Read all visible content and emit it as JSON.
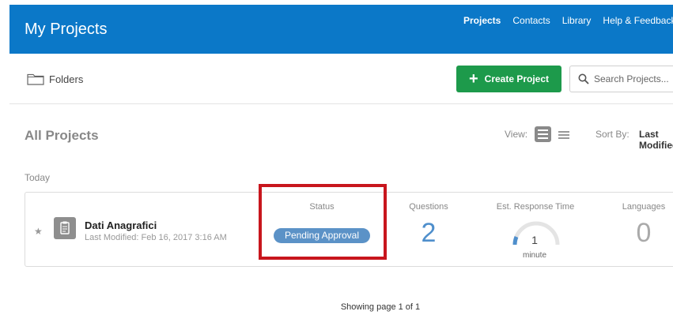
{
  "header": {
    "title": "My Projects",
    "nav": [
      "Projects",
      "Contacts",
      "Library",
      "Help & Feedback"
    ]
  },
  "toolbar": {
    "folders_label": "Folders",
    "create_label": "Create Project",
    "search_placeholder": "Search Projects..."
  },
  "list": {
    "section_title": "All Projects",
    "view_label": "View:",
    "sort_label": "Sort By:",
    "sort_value": "Last Modified",
    "group_label": "Today"
  },
  "project": {
    "name": "Dati Anagrafici",
    "last_modified": "Last Modified: Feb 16, 2017 3:16 AM",
    "status_label": "Status",
    "status_value": "Pending Approval",
    "questions_label": "Questions",
    "questions_value": "2",
    "response_label": "Est. Response Time",
    "response_value": "1",
    "response_unit": "minute",
    "languages_label": "Languages",
    "languages_value": "0"
  },
  "pager": "Showing page 1 of 1",
  "colors": {
    "header_bg": "#0b78c8",
    "create_bg": "#1d9a4b",
    "status_bg": "#5b92c7",
    "questions_color": "#4f8fcc",
    "highlight": "#c8161d"
  }
}
